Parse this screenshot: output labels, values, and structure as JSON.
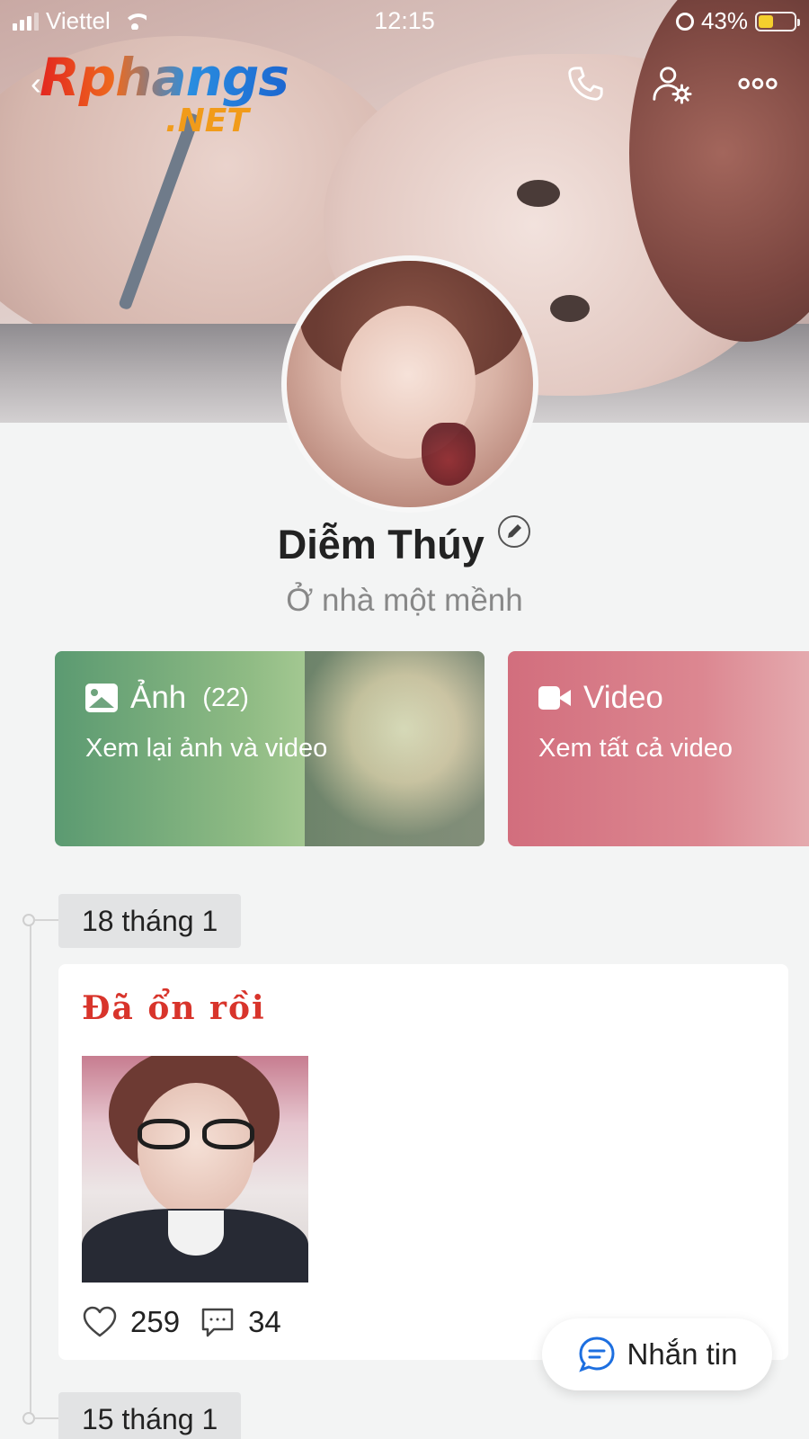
{
  "status_bar": {
    "carrier": "Viettel",
    "time": "12:15",
    "battery_percent": "43%",
    "battery_level": 0.43
  },
  "header": {
    "back_icon": "chevron-left-icon",
    "logo_main": "Rphangs",
    "logo_suffix": ".NET",
    "actions": [
      "phone-icon",
      "user-settings-icon",
      "more-icon"
    ]
  },
  "profile": {
    "name": "Diễm Thúy",
    "bio": "Ở nhà một mềnh"
  },
  "cards": {
    "photos": {
      "title": "Ảnh",
      "count": "(22)",
      "subtitle": "Xem lại ảnh và video"
    },
    "videos": {
      "title": "Video",
      "subtitle": "Xem tất cả video"
    }
  },
  "timeline": [
    {
      "date": "18 tháng 1",
      "headline": "Đã ổn rồi",
      "likes": "259",
      "comments": "34"
    },
    {
      "date": "15 tháng 1"
    }
  ],
  "message_button": {
    "label": "Nhắn tin"
  },
  "colors": {
    "background": "#f3f4f4",
    "photo_card": "#5b9a71",
    "video_card": "#d26e7d",
    "headline_red": "#d8342b",
    "message_icon_blue": "#1d6fe0"
  }
}
